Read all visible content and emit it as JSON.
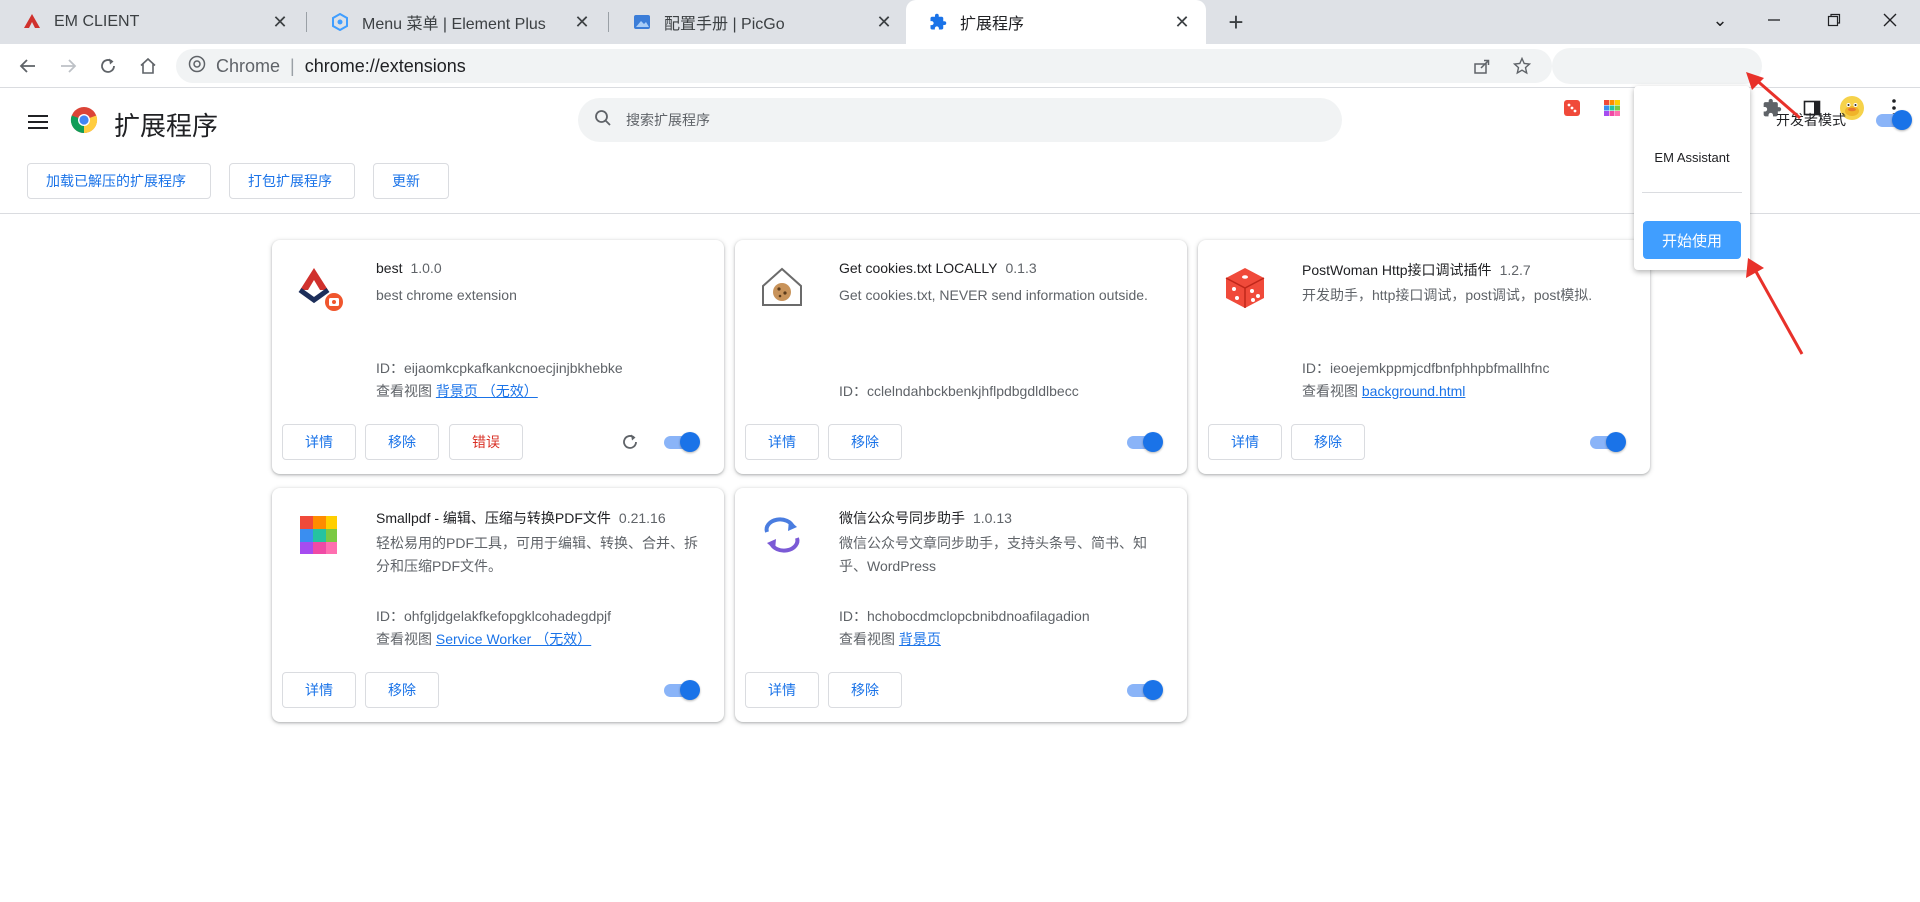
{
  "tabs": [
    {
      "title": "EM CLIENT",
      "icon": "em-client-icon"
    },
    {
      "title": "Menu 菜单 | Element Plus",
      "icon": "element-plus-icon"
    },
    {
      "title": "配置手册 | PicGo",
      "icon": "picgo-icon"
    },
    {
      "title": "扩展程序",
      "icon": "puzzle-icon",
      "active": true
    }
  ],
  "omnibox": {
    "site": "Chrome",
    "separator": "|",
    "url": "chrome://extensions"
  },
  "toolbar": {
    "ext_badge": "0"
  },
  "header": {
    "title": "扩展程序",
    "search_placeholder": "搜索扩展程序",
    "dev_mode_label": "开发者模式",
    "dev_mode_on": true
  },
  "actions": {
    "load_unpacked": "加载已解压的扩展程序",
    "pack": "打包扩展程序",
    "update": "更新"
  },
  "labels": {
    "details": "详情",
    "remove": "移除",
    "errors": "错误",
    "id_prefix": "ID：",
    "inspect_views": "查看视图"
  },
  "extensions": [
    {
      "name": "best",
      "version": "1.0.0",
      "description": "best chrome extension",
      "id": "eijaomkcpkafkankcnoecjinjbkhebke",
      "view_link": "背景页 （无效）",
      "enabled": true
    },
    {
      "name": "Get cookies.txt LOCALLY",
      "version": "0.1.3",
      "description": "Get cookies.txt, NEVER send information outside.",
      "id": "cclelndahbckbenkjhflpdbgdldlbecc",
      "enabled": true
    },
    {
      "name": "PostWoman Http接口调试插件",
      "version": "1.2.7",
      "description": "开发助手，http接口调试，post调试，post模拟.",
      "id": "ieoejemkppmjcdfbnfphhpbfmallhfnc",
      "view_link": "background.html",
      "enabled": true
    },
    {
      "name": "Smallpdf - 编辑、压缩与转换PDF文件",
      "version": "0.21.16",
      "description": "轻松易用的PDF工具，可用于编辑、转换、合并、拆分和压缩PDF文件。",
      "id": "ohfgljdgelakfkefopgklcohadegdpjf",
      "view_link": "Service Worker （无效）",
      "enabled": true
    },
    {
      "name": "微信公众号同步助手",
      "version": "1.0.13",
      "description": "微信公众号文章同步助手，支持头条号、简书、知乎、WordPress",
      "id": "hchobocdmclopcbnibdnoafilagadion",
      "view_link": "背景页",
      "enabled": true
    }
  ],
  "popup": {
    "title": "EM Assistant",
    "button": "开始使用"
  },
  "colors": {
    "accent": "#1a73e8",
    "error": "#d93025",
    "popup_button": "#409eff",
    "annotation_arrow": "#e8312a"
  }
}
